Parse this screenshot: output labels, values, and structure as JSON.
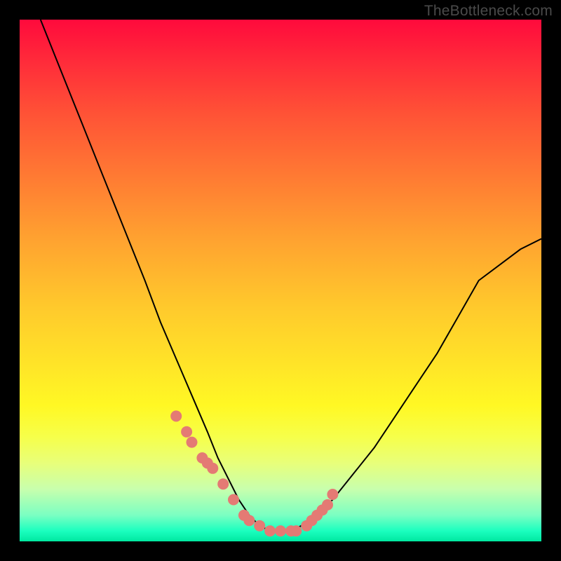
{
  "watermark": "TheBottleneck.com",
  "colors": {
    "marker": "#e47a74",
    "curve": "#000000",
    "frame_bg_top": "#ff0a3c",
    "frame_bg_bottom": "#00e8a0",
    "page_bg": "#000000"
  },
  "chart_data": {
    "type": "line",
    "title": "",
    "xlabel": "",
    "ylabel": "",
    "xlim": [
      0,
      100
    ],
    "ylim": [
      0,
      100
    ],
    "grid": false,
    "legend": false,
    "series": [
      {
        "name": "bottleneck-curve",
        "x": [
          4,
          8,
          12,
          16,
          20,
          24,
          27,
          30,
          33,
          36,
          38,
          40,
          42,
          44,
          46,
          48,
          50,
          52,
          54,
          57,
          60,
          64,
          68,
          72,
          76,
          80,
          84,
          88,
          92,
          96,
          100
        ],
        "values": [
          100,
          90,
          80,
          70,
          60,
          50,
          42,
          35,
          28,
          21,
          16,
          12,
          8,
          5,
          3,
          2,
          2,
          2,
          3,
          5,
          8,
          13,
          18,
          24,
          30,
          36,
          43,
          50,
          53,
          56,
          58
        ]
      }
    ],
    "markers": {
      "name": "highlighted-points",
      "x": [
        30,
        32,
        33,
        35,
        36,
        37,
        39,
        41,
        43,
        44,
        46,
        48,
        50,
        52,
        53,
        55,
        56,
        57,
        58,
        59,
        60
      ],
      "values": [
        24,
        21,
        19,
        16,
        15,
        14,
        11,
        8,
        5,
        4,
        3,
        2,
        2,
        2,
        2,
        3,
        4,
        5,
        6,
        7,
        9
      ]
    }
  }
}
